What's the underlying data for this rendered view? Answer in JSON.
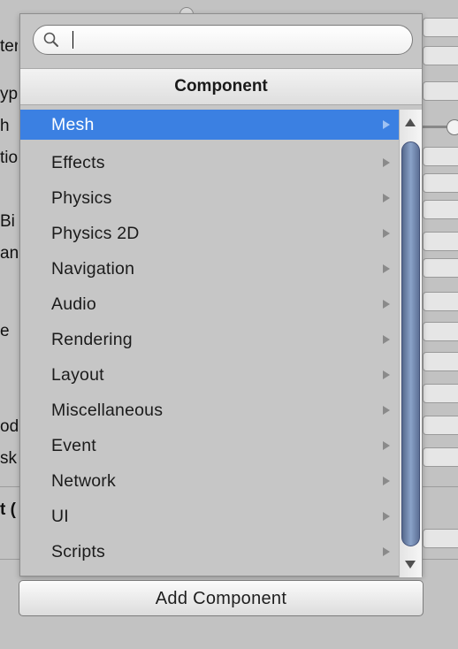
{
  "inspector": {
    "label_fragments": [
      "ter",
      "ype",
      "h",
      "tio",
      "Bi",
      "an",
      "e",
      "od",
      "sk",
      "t ("
    ]
  },
  "popup": {
    "search": {
      "value": "",
      "placeholder": ""
    },
    "header": "Component",
    "selected_index": 0,
    "items": [
      {
        "label": "Mesh",
        "has_submenu": true
      },
      {
        "label": "Effects",
        "has_submenu": true
      },
      {
        "label": "Physics",
        "has_submenu": true
      },
      {
        "label": "Physics 2D",
        "has_submenu": true
      },
      {
        "label": "Navigation",
        "has_submenu": true
      },
      {
        "label": "Audio",
        "has_submenu": true
      },
      {
        "label": "Rendering",
        "has_submenu": true
      },
      {
        "label": "Layout",
        "has_submenu": true
      },
      {
        "label": "Miscellaneous",
        "has_submenu": true
      },
      {
        "label": "Event",
        "has_submenu": true
      },
      {
        "label": "Network",
        "has_submenu": true
      },
      {
        "label": "UI",
        "has_submenu": true
      },
      {
        "label": "Scripts",
        "has_submenu": true
      }
    ],
    "selection_color": "#3b80e2"
  },
  "add_component_label": "Add Component"
}
